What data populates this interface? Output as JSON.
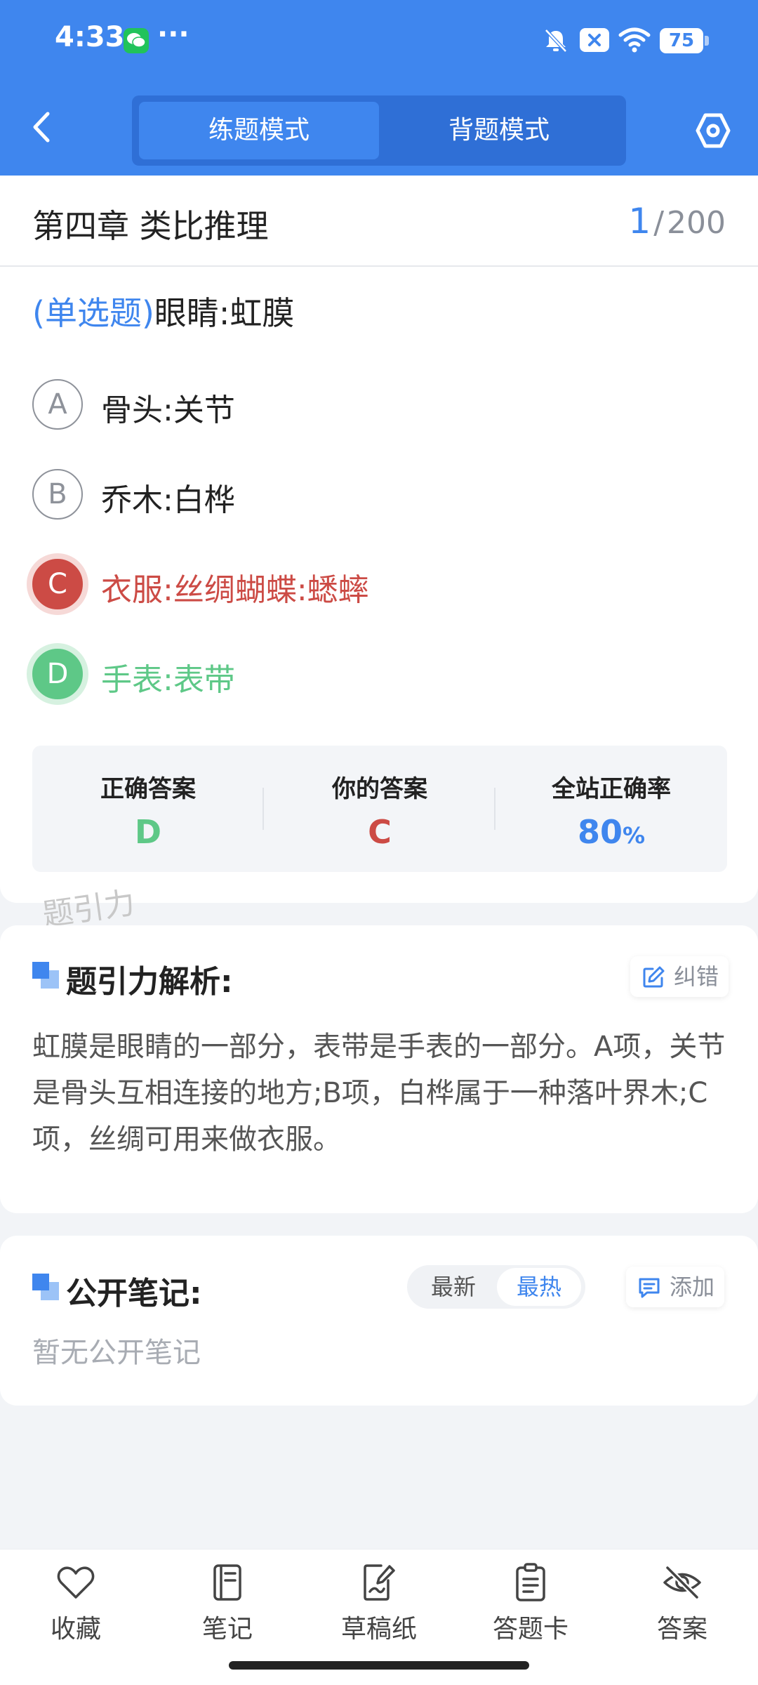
{
  "status_bar": {
    "time": "4:33",
    "dots": "···",
    "battery": "75"
  },
  "header": {
    "modes": [
      {
        "label": "练题模式",
        "active": true
      },
      {
        "label": "背题模式",
        "active": false
      }
    ]
  },
  "question": {
    "chapter": "第四章 类比推理",
    "progress_current": "1",
    "progress_sep": "/",
    "progress_total": "200",
    "type": "(单选题)",
    "stem": "眼睛:虹膜",
    "options": [
      {
        "letter": "A",
        "text": "骨头:关节",
        "state": "normal"
      },
      {
        "letter": "B",
        "text": "乔木:白桦",
        "state": "normal"
      },
      {
        "letter": "C",
        "text": "衣服:丝绸蝴蝶:蟋蟀",
        "state": "wrong"
      },
      {
        "letter": "D",
        "text": "手表:表带",
        "state": "correct"
      }
    ]
  },
  "stats": {
    "correct_label": "正确答案",
    "correct_value": "D",
    "yours_label": "你的答案",
    "yours_value": "C",
    "rate_label": "全站正确率",
    "rate_value": "80",
    "rate_unit": "%"
  },
  "watermark": "题引力",
  "analysis": {
    "title": "题引力解析:",
    "report_label": "纠错",
    "text": "虹膜是眼睛的一部分，表带是手表的一部分。A项，关节是骨头互相连接的地方;B项，白桦属于一种落叶界木;C项，丝绸可用来做衣服。"
  },
  "notes": {
    "title": "公开笔记:",
    "sort_newest": "最新",
    "sort_hottest": "最热",
    "add_label": "添加",
    "empty": "暂无公开笔记"
  },
  "bottom_bar": [
    {
      "label": "收藏",
      "icon": "heart-icon"
    },
    {
      "label": "笔记",
      "icon": "notebook-icon"
    },
    {
      "label": "草稿纸",
      "icon": "draft-icon"
    },
    {
      "label": "答题卡",
      "icon": "answer-card-icon"
    },
    {
      "label": "答案",
      "icon": "eye-off-icon"
    }
  ],
  "colors": {
    "primary": "#3f86ee",
    "wrong": "#cc4b45",
    "correct": "#5ec887"
  }
}
